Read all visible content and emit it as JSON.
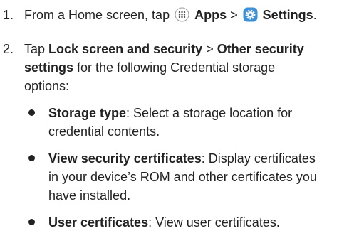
{
  "step1": {
    "number": "1.",
    "prefix": "From a Home screen, tap",
    "apps_icon": "apps-grid-icon",
    "apps_label": "Apps",
    "separator": ">",
    "settings_icon": "settings-gear-icon",
    "settings_label": "Settings",
    "suffix": "."
  },
  "step2": {
    "number": "2.",
    "prefix": "Tap",
    "lock_label": "Lock screen and security",
    "separator": ">",
    "other_label": "Other security",
    "other_label_2": "settings",
    "line2_rest": "for the following Credential storage",
    "line3": "options:"
  },
  "bullets": [
    {
      "term": "Storage type",
      "line1_rest": ": Select a storage location for",
      "line2": "credential contents."
    },
    {
      "term": "View security certificates",
      "line1_rest": ": Display certificates",
      "line2": "in your device’s ROM and other certificates you",
      "line3": "have installed."
    },
    {
      "term": "User certificates",
      "line1_rest": ": View user certificates."
    }
  ],
  "colors": {
    "text": "#222222",
    "settings_icon_bg": "#3d8fd6"
  }
}
